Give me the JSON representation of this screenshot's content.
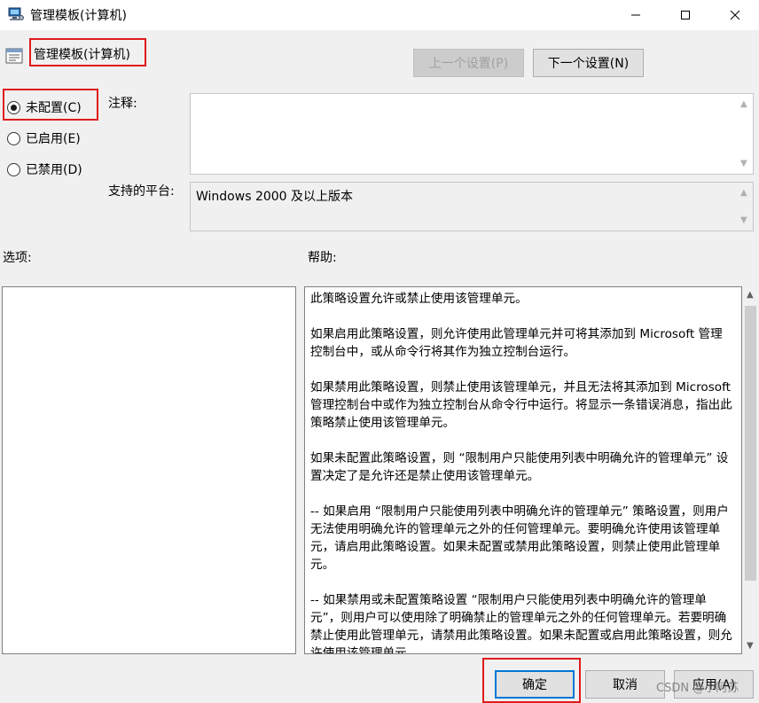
{
  "window": {
    "title": "管理模板(计算机)"
  },
  "header": {
    "title": "管理模板(计算机)",
    "prev_button": "上一个设置(P)",
    "next_button": "下一个设置(N)"
  },
  "state": {
    "options": [
      {
        "label": "未配置(C)",
        "checked": true
      },
      {
        "label": "已启用(E)",
        "checked": false
      },
      {
        "label": "已禁用(D)",
        "checked": false
      }
    ]
  },
  "fields": {
    "comment_label": "注释:",
    "comment_value": "",
    "platform_label": "支持的平台:",
    "platform_value": "Windows 2000 及以上版本"
  },
  "sections": {
    "options_label": "选项:",
    "help_label": "帮助:"
  },
  "help": {
    "paragraphs": [
      "此策略设置允许或禁止使用该管理单元。",
      "如果启用此策略设置，则允许使用此管理单元并可将其添加到 Microsoft 管理控制台中，或从命令行将其作为独立控制台运行。",
      "如果禁用此策略设置，则禁止使用该管理单元，并且无法将其添加到 Microsoft 管理控制台中或作为独立控制台从命令行中运行。将显示一条错误消息，指出此策略禁止使用该管理单元。",
      "如果未配置此策略设置，则 “限制用户只能使用列表中明确允许的管理单元” 设置决定了是允许还是禁止使用该管理单元。",
      "-- 如果启用 “限制用户只能使用列表中明确允许的管理单元” 策略设置，则用户无法使用明确允许的管理单元之外的任何管理单元。要明确允许使用该管理单元，请启用此策略设置。如果未配置或禁用此策略设置，则禁止使用此管理单元。",
      "-- 如果禁用或未配置策略设置 “限制用户只能使用列表中明确允许的管理单元”，则用户可以使用除了明确禁止的管理单元之外的任何管理单元。若要明确禁止使用此管理单元，请禁用此策略设置。如果未配置或启用此策略设置，则允许使用该管理单元。"
    ]
  },
  "footer": {
    "ok_button": "确定",
    "cancel_button": "取消",
    "apply_button": "应用(A)",
    "watermark": "CSDN @小阿苏"
  },
  "colors": {
    "highlight_border": "#e01b1b",
    "focus_border": "#0078d7"
  }
}
